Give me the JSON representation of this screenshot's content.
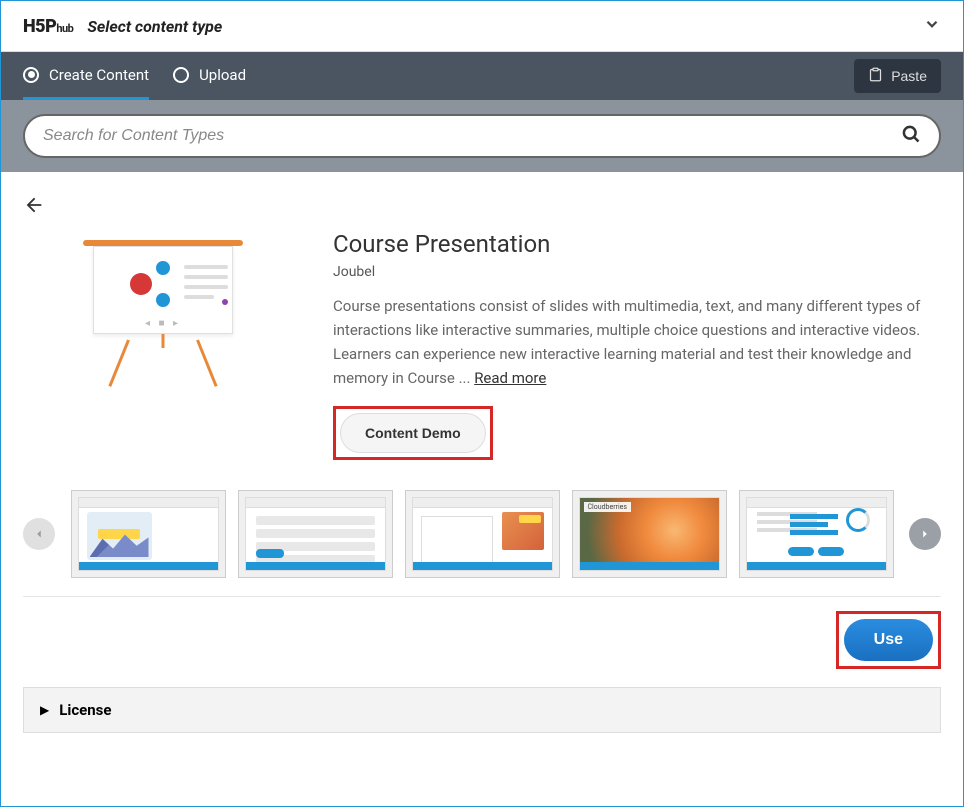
{
  "header": {
    "logo": "H5P",
    "logo_sub": "hub",
    "title": "Select content type"
  },
  "tabs": {
    "create": "Create Content",
    "upload": "Upload"
  },
  "paste": {
    "label": "Paste"
  },
  "search": {
    "placeholder": "Search for Content Types"
  },
  "detail": {
    "title": "Course Presentation",
    "author": "Joubel",
    "description": "Course presentations consist of slides with multimedia, text, and many different types of interactions like interactive summaries, multiple choice questions and interactive videos. Learners can experience new interactive learning material and test their knowledge and memory in Course ... ",
    "read_more": "Read more",
    "demo_label": "Content Demo"
  },
  "thumb4_label": "Cloudberries",
  "use_label": "Use",
  "license_label": "License"
}
